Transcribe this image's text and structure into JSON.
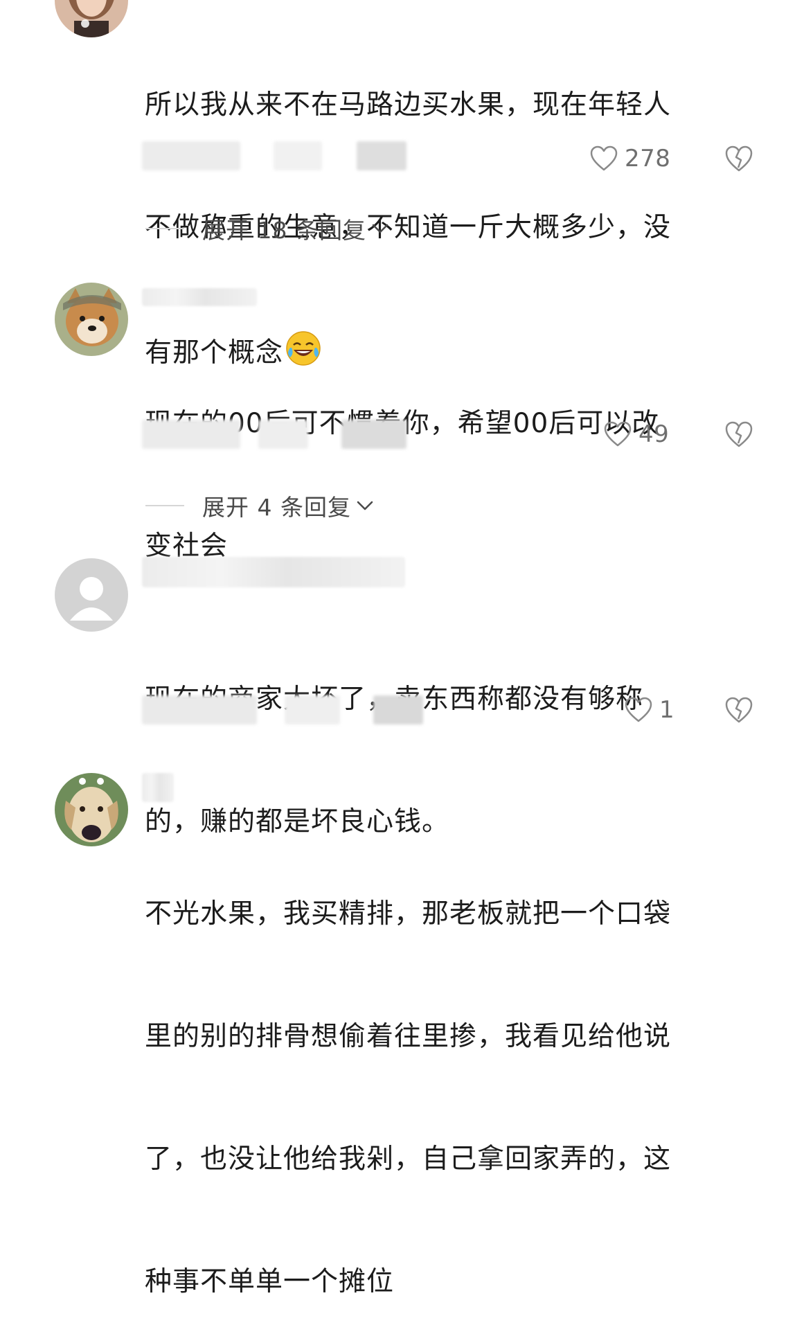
{
  "comments": [
    {
      "text_lines": [
        "所以我从来不在马路边买水果，现在年轻人",
        "不做称重的生意，不知道一斤大概多少，没",
        "有那个概念"
      ],
      "emoji": "rolling-laughing-emoji",
      "likes": "278",
      "expand_label": "展开 18 条回复",
      "avatar": "woman-photo-avatar"
    },
    {
      "text_lines": [
        "现在的00后可不惯着你，希望00后可以改",
        "变社会"
      ],
      "likes": "49",
      "expand_label": "展开 4 条回复",
      "avatar": "shiba-dog-avatar"
    },
    {
      "text_lines": [
        "现在的商家太坏了，卖东西称都没有够称",
        "的，赚的都是坏良心钱。"
      ],
      "likes": "1",
      "avatar": "default-person-avatar"
    },
    {
      "text_lines": [
        "不光水果，我买精排，那老板就把一个口袋",
        "里的别的排骨想偷着往里掺，我看见给他说",
        "了，也没让他给我剁，自己拿回家弄的，这",
        "种事不单单一个摊位"
      ],
      "avatar": "dog-photo-avatar"
    }
  ],
  "icons": {
    "like": "heart-outline-icon",
    "dislike": "broken-heart-icon",
    "expand": "chevron-down-icon"
  },
  "colors": {
    "text": "#1c1c1c",
    "meta": "#6f6f6f",
    "icon": "#8a8a8a",
    "divider": "#d6d6d6"
  }
}
